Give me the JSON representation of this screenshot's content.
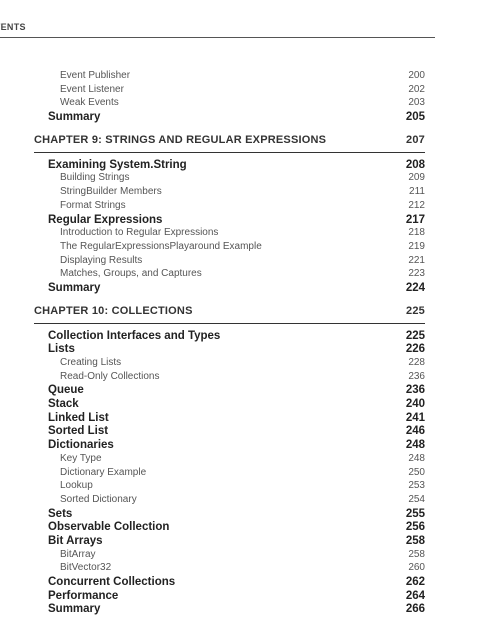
{
  "running_head": "NTENTS",
  "toc": {
    "entries": [
      {
        "level": "sub",
        "title": "Event Publisher",
        "page": "200"
      },
      {
        "level": "sub",
        "title": "Event Listener",
        "page": "202"
      },
      {
        "level": "sub",
        "title": "Weak Events",
        "page": "203"
      },
      {
        "level": "sec",
        "title": "Summary",
        "page": "205"
      },
      {
        "level": "chap",
        "title": "CHAPTER 9: STRINGS AND REGULAR EXPRESSIONS",
        "page": "207"
      },
      {
        "level": "sec",
        "title": "Examining System.String",
        "page": "208"
      },
      {
        "level": "sub",
        "title": "Building Strings",
        "page": "209"
      },
      {
        "level": "sub",
        "title": "StringBuilder Members",
        "page": "211"
      },
      {
        "level": "sub",
        "title": "Format Strings",
        "page": "212"
      },
      {
        "level": "sec",
        "title": "Regular Expressions",
        "page": "217"
      },
      {
        "level": "sub",
        "title": "Introduction to Regular Expressions",
        "page": "218"
      },
      {
        "level": "sub",
        "title": "The RegularExpressionsPlayaround Example",
        "page": "219"
      },
      {
        "level": "sub",
        "title": "Displaying Results",
        "page": "221"
      },
      {
        "level": "sub",
        "title": "Matches, Groups, and Captures",
        "page": "223"
      },
      {
        "level": "sec",
        "title": "Summary",
        "page": "224"
      },
      {
        "level": "chap",
        "title": "CHAPTER 10: COLLECTIONS",
        "page": "225"
      },
      {
        "level": "sec",
        "title": "Collection Interfaces and Types",
        "page": "225"
      },
      {
        "level": "sec",
        "title": "Lists",
        "page": "226"
      },
      {
        "level": "sub",
        "title": "Creating Lists",
        "page": "228"
      },
      {
        "level": "sub",
        "title": "Read-Only Collections",
        "page": "236"
      },
      {
        "level": "sec",
        "title": "Queue",
        "page": "236"
      },
      {
        "level": "sec",
        "title": "Stack",
        "page": "240"
      },
      {
        "level": "sec",
        "title": "Linked List",
        "page": "241"
      },
      {
        "level": "sec",
        "title": "Sorted List",
        "page": "246"
      },
      {
        "level": "sec",
        "title": "Dictionaries",
        "page": "248"
      },
      {
        "level": "sub",
        "title": "Key Type",
        "page": "248"
      },
      {
        "level": "sub",
        "title": "Dictionary Example",
        "page": "250"
      },
      {
        "level": "sub",
        "title": "Lookup",
        "page": "253"
      },
      {
        "level": "sub",
        "title": "Sorted Dictionary",
        "page": "254"
      },
      {
        "level": "sec",
        "title": "Sets",
        "page": "255"
      },
      {
        "level": "sec",
        "title": "Observable Collection",
        "page": "256"
      },
      {
        "level": "sec",
        "title": "Bit Arrays",
        "page": "258"
      },
      {
        "level": "sub",
        "title": "BitArray",
        "page": "258"
      },
      {
        "level": "sub",
        "title": "BitVector32",
        "page": "260"
      },
      {
        "level": "sec",
        "title": "Concurrent Collections",
        "page": "262"
      },
      {
        "level": "sec",
        "title": "Performance",
        "page": "264"
      },
      {
        "level": "sec",
        "title": "Summary",
        "page": "266"
      }
    ]
  }
}
